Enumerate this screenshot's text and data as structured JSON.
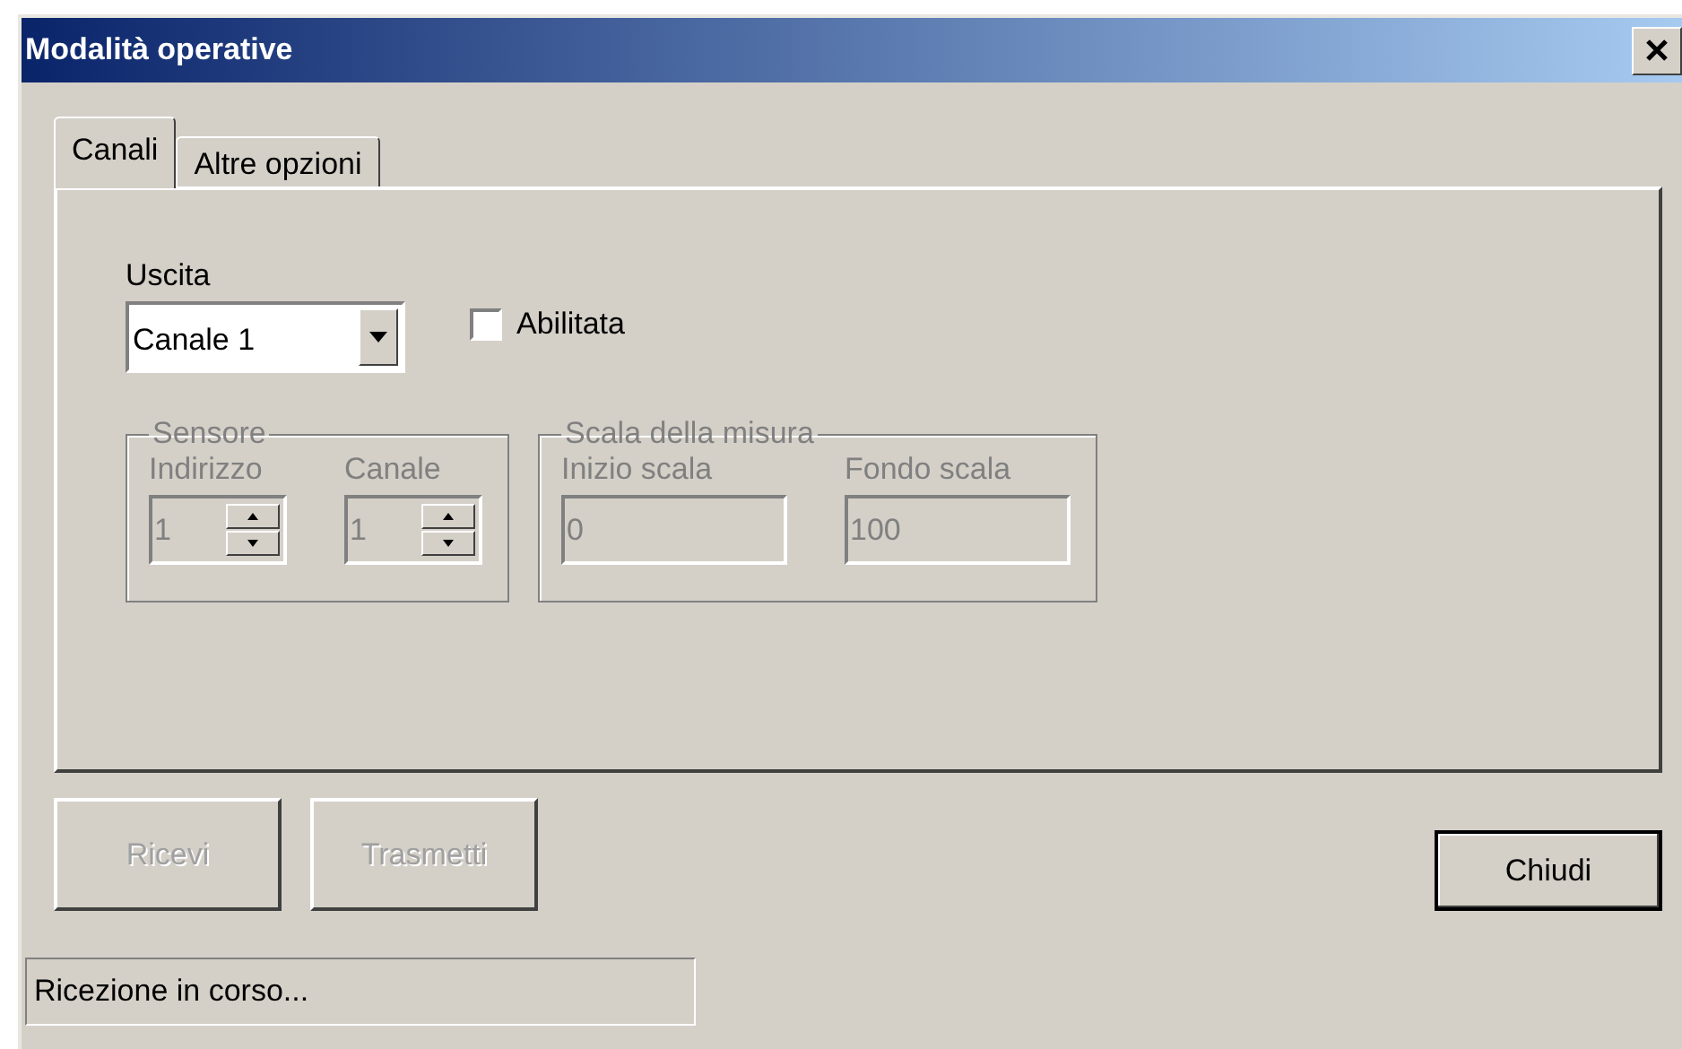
{
  "window": {
    "title": "Modalità operative"
  },
  "tabs": [
    {
      "label": "Canali",
      "selected": true
    },
    {
      "label": "Altre opzioni",
      "selected": false
    }
  ],
  "output": {
    "label": "Uscita",
    "value": "Canale 1",
    "enabled_label": "Abilitata",
    "checked": false
  },
  "groups": [
    {
      "title": "Sensore",
      "disabled": true,
      "fields": [
        {
          "kind": "spin",
          "label": "Indirizzo",
          "value": "1"
        },
        {
          "kind": "spin",
          "label": "Canale",
          "value": "1"
        }
      ]
    },
    {
      "title": "Scala della misura",
      "disabled": true,
      "fields": [
        {
          "kind": "text",
          "label": "Inizio scala",
          "value": "0"
        },
        {
          "kind": "text",
          "label": "Fondo scala",
          "value": "100"
        }
      ]
    }
  ],
  "buttons": [
    {
      "label": "Ricevi",
      "disabled": true,
      "default": false
    },
    {
      "label": "Trasmetti",
      "disabled": true,
      "default": false
    },
    {
      "label": "Chiudi",
      "disabled": false,
      "default": true
    }
  ],
  "status_bar": "Ricezione in corso..."
}
